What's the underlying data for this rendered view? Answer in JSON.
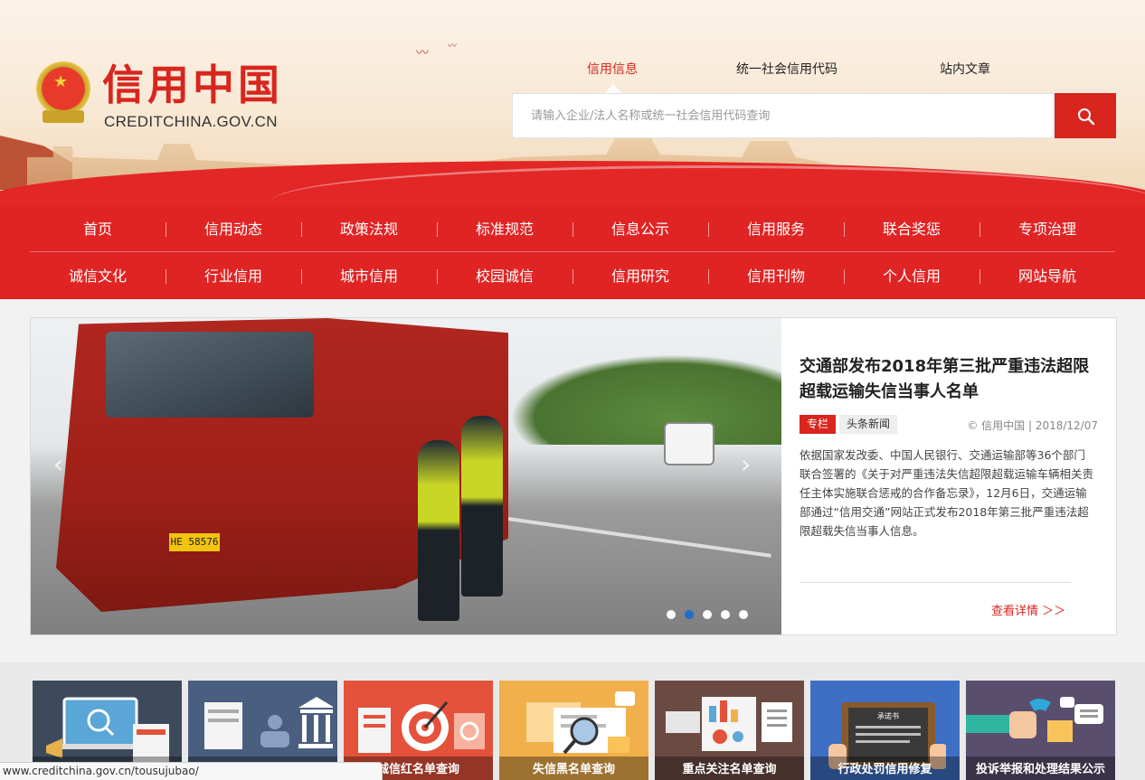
{
  "header": {
    "logo_title": "信用中国",
    "logo_subtitle": "CREDITCHINA.GOV.CN",
    "search_tabs": [
      {
        "label": "信用信息",
        "active": true
      },
      {
        "label": "统一社会信用代码",
        "active": false
      },
      {
        "label": "站内文章",
        "active": false
      }
    ],
    "search_placeholder": "请输入企业/法人名称或统一社会信用代码查询",
    "search_icon": "search-icon"
  },
  "nav": {
    "row1": [
      "首页",
      "信用动态",
      "政策法规",
      "标准规范",
      "信息公示",
      "信用服务",
      "联合奖惩",
      "专项治理"
    ],
    "row2": [
      "诚信文化",
      "行业信用",
      "城市信用",
      "校园诚信",
      "信用研究",
      "信用刊物",
      "个人信用",
      "网站导航"
    ]
  },
  "featured": {
    "plate_text": "HE 58576",
    "title": "交通部发布2018年第三批严重违法超限超载运输失信当事人名单",
    "tag_primary": "专栏",
    "tag_secondary": "头条新闻",
    "meta": "© 信用中国 | 2018/12/07",
    "body": "依据国家发改委、中国人民银行、交通运输部等36个部门联合签署的《关于对严重违法失信超限超载运输车辆相关责任主体实施联合惩戒的合作备忘录》，12月6日，交通运输部通过“信用交通”网站正式发布2018年第三批严重违法超限超载失信当事人信息。",
    "more_link": "查看详情 ＞＞",
    "slide_count": 5,
    "active_slide": 2,
    "arrow_left": "‹",
    "arrow_right": "›"
  },
  "tiles": [
    {
      "label": "",
      "color": "#3d4a5c",
      "icon": "monitor-search-icon"
    },
    {
      "label": "",
      "color": "#4a5f80",
      "icon": "government-building-icon"
    },
    {
      "label": "诚信红名单查询",
      "color": "#e4523b",
      "icon": "target-icon"
    },
    {
      "label": "失信黑名单查询",
      "color": "#f1b04c",
      "icon": "magnifier-document-icon"
    },
    {
      "label": "重点关注名单查询",
      "color": "#6b4a42",
      "icon": "chart-report-icon"
    },
    {
      "label": "行政处罚信用修复",
      "color": "#3f6fc4",
      "icon": "commitment-letter-icon"
    },
    {
      "label": "投诉举报和处理结果公示",
      "color": "#5a4e6e",
      "icon": "phone-complaint-icon"
    }
  ],
  "status_bar": {
    "url": "www.creditchina.gov.cn/tousujubao/"
  },
  "colors": {
    "brand_red": "#d8261e",
    "nav_red": "#e02424",
    "dot_active": "#1a6fc9"
  }
}
